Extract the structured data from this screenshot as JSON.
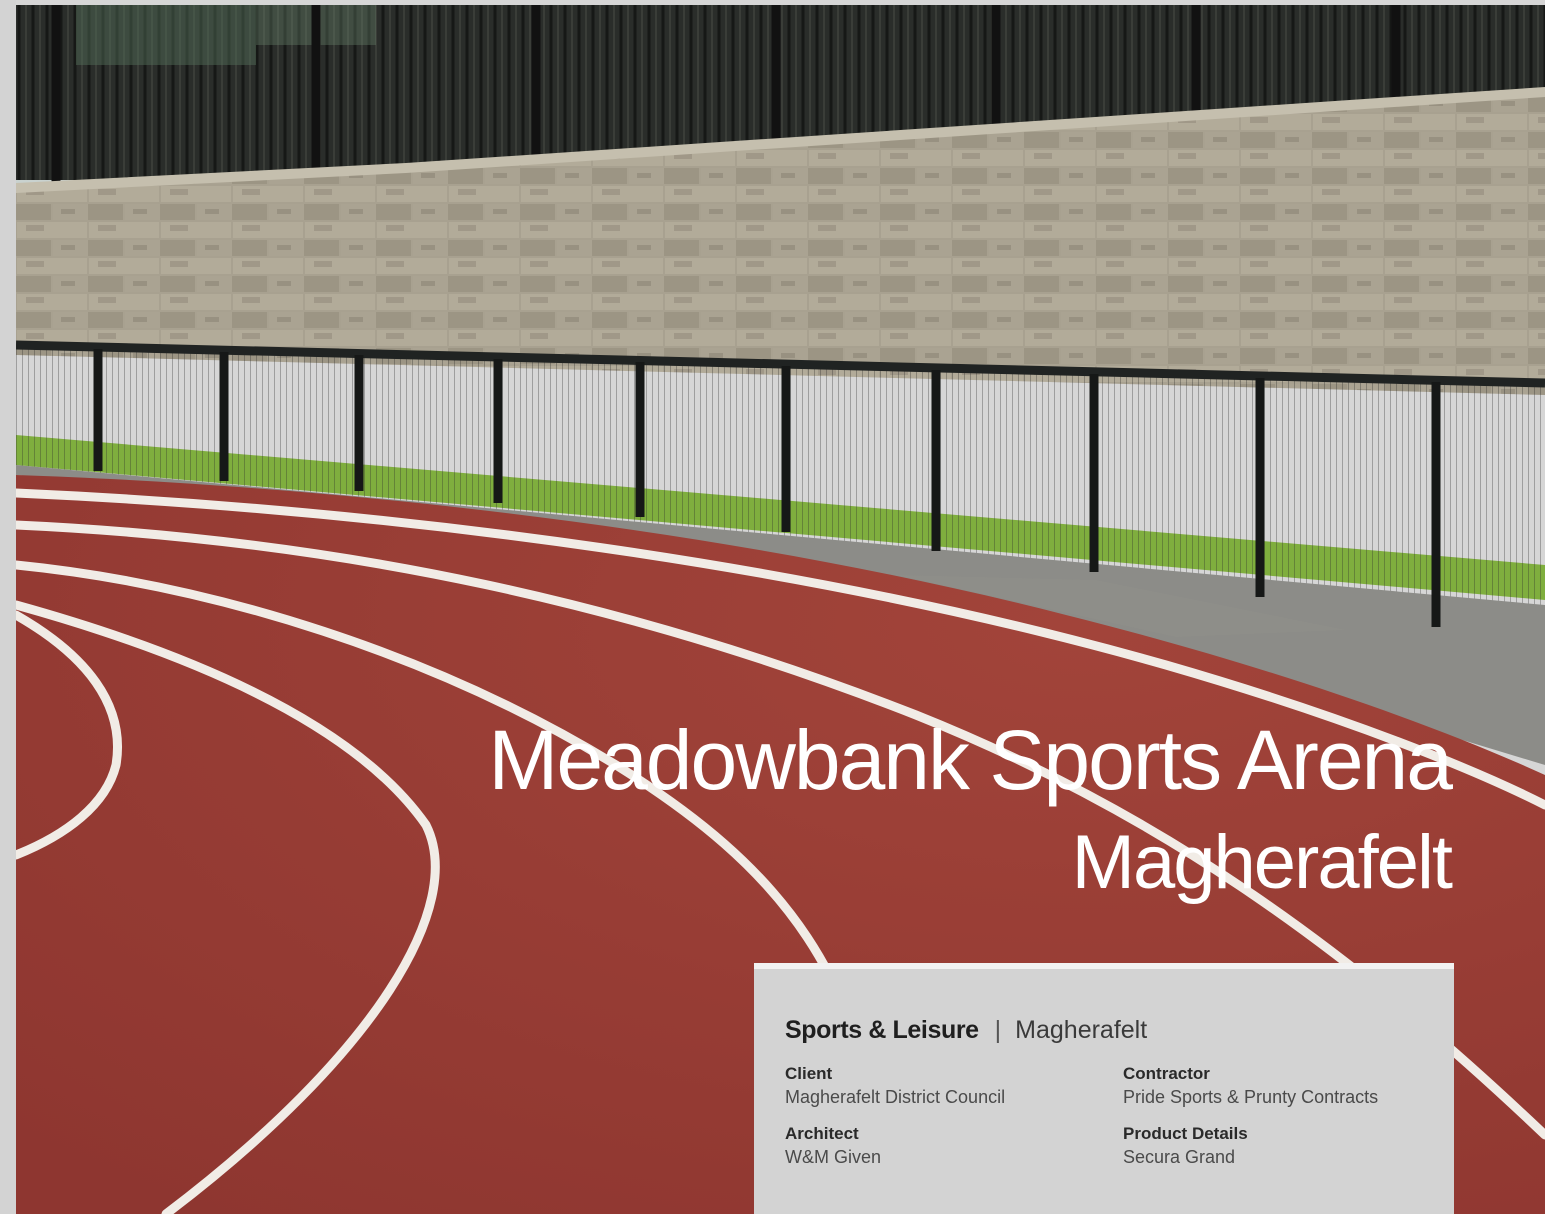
{
  "page": {
    "title_line1": "Meadowbank Sports Arena",
    "title_line2": "Magherafelt"
  },
  "card": {
    "category": "Sports & Leisure",
    "separator": "|",
    "location": "Magherafelt",
    "fields": [
      {
        "label": "Client",
        "value": "Magherafelt District Council"
      },
      {
        "label": "Contractor",
        "value": "Pride Sports & Prunty Contracts"
      },
      {
        "label": "Architect",
        "value": "W&M Given"
      },
      {
        "label": "Product Details",
        "value": "Secura Grand"
      }
    ]
  },
  "colors": {
    "track": "#9b3d35",
    "lane_line": "#f1ece6",
    "wall": "#a59d8c",
    "grass": "#7fae3e",
    "card_bg": "#d3d3d3"
  }
}
